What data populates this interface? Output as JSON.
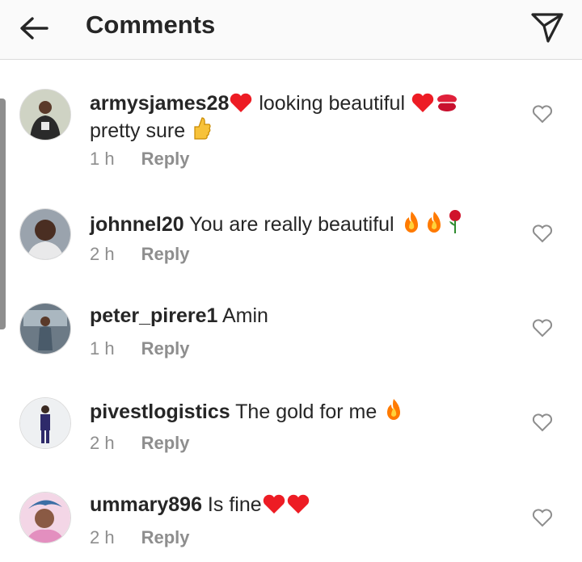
{
  "header": {
    "title": "Comments",
    "back_icon": "back-arrow-icon",
    "share_icon": "direct-send-icon"
  },
  "comments": [
    {
      "username": "armysjames28",
      "text1": " looking beautiful ",
      "text2": "pretty sure ",
      "time": "1 h",
      "reply": "Reply",
      "emojis": [
        "red-heart",
        "red-heart",
        "kiss-mark",
        "thumbs-up"
      ]
    },
    {
      "username": "johnnel20",
      "text1": " You are really beautiful ",
      "time": "2 h",
      "reply": "Reply",
      "emojis": [
        "fire",
        "fire",
        "rose"
      ]
    },
    {
      "username": "peter_pirere1",
      "text1": " Amin",
      "time": "1 h",
      "reply": "Reply",
      "emojis": []
    },
    {
      "username": "pivestlogistics",
      "text1": " The gold for me ",
      "time": "2 h",
      "reply": "Reply",
      "emojis": [
        "fire"
      ]
    },
    {
      "username": "ummary896",
      "text1": " Is fine",
      "time": "2 h",
      "reply": "Reply",
      "emojis": [
        "red-heart",
        "red-heart"
      ]
    }
  ],
  "colors": {
    "text": "#262626",
    "secondary": "#8e8e8e",
    "divider": "#dbdbdb",
    "heart_emoji": "#ed1c24",
    "fire": "#ff7a00"
  }
}
